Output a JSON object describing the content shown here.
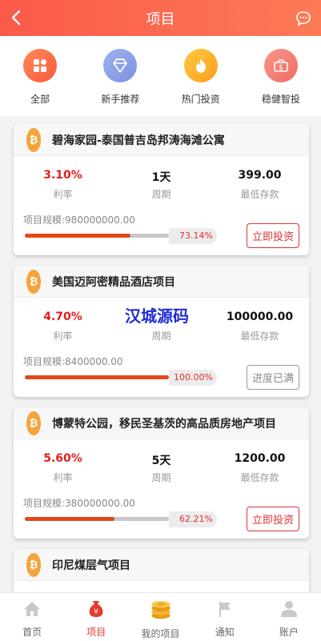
{
  "header": {
    "title": "项目",
    "back_icon": "chevron-left-icon",
    "chat_icon": "chat-bubble-icon"
  },
  "categories": [
    {
      "label": "全部",
      "icon": "grid-icon",
      "color": "#fb6e45"
    },
    {
      "label": "新手推荐",
      "icon": "diamond-icon",
      "color": "#8aa0e8"
    },
    {
      "label": "热门投资",
      "icon": "flame-icon",
      "color": "#fdb12e"
    },
    {
      "label": "稳健智投",
      "icon": "money-bag-icon",
      "color": "#f47b73"
    }
  ],
  "projects": [
    {
      "title": "碧海家园-泰国普吉岛邦涛海滩公寓",
      "rate": "3.10%",
      "rate_label": "利率",
      "period": "1天",
      "period_label": "周期",
      "min": "399.00",
      "min_label": "最低存款",
      "scale": "项目规模:980000000.00",
      "progress": 73.14,
      "progress_text": "73.14%",
      "button": "立即投资",
      "full": false
    },
    {
      "title": "美国迈阿密精品酒店项目",
      "rate": "4.70%",
      "rate_label": "利率",
      "period": "",
      "period_label": "周期",
      "min": "100000.00",
      "min_label": "最低存款",
      "scale": "项目规模:8400000.00",
      "progress": 100,
      "progress_text": "100.00%",
      "button": "进度已满",
      "full": true
    },
    {
      "title": "博蒙特公园，移民圣基茨的高品质房地产项目",
      "rate": "5.60%",
      "rate_label": "利率",
      "period": "5天",
      "period_label": "周期",
      "min": "1200.00",
      "min_label": "最低存款",
      "scale": "项目规模:380000000.00",
      "progress": 62.21,
      "progress_text": "62.21%",
      "button": "立即投资",
      "full": false
    },
    {
      "title": "印尼煤层气项目"
    }
  ],
  "watermark": "汉城源码",
  "coin_symbol": "₿",
  "tabs": [
    {
      "label": "首页",
      "icon": "home-icon",
      "active": false
    },
    {
      "label": "项目",
      "icon": "money-bag-icon",
      "active": true
    },
    {
      "label": "我的项目",
      "icon": "coins-icon",
      "active": false
    },
    {
      "label": "通知",
      "icon": "flag-icon",
      "active": false
    },
    {
      "label": "账户",
      "icon": "user-icon",
      "active": false
    }
  ],
  "colors": {
    "header_start": "#fb5a4a",
    "header_end": "#fd7a55",
    "accent_red": "#e01f1f",
    "progress": "#e2481d",
    "coin": "#f5a33b"
  }
}
